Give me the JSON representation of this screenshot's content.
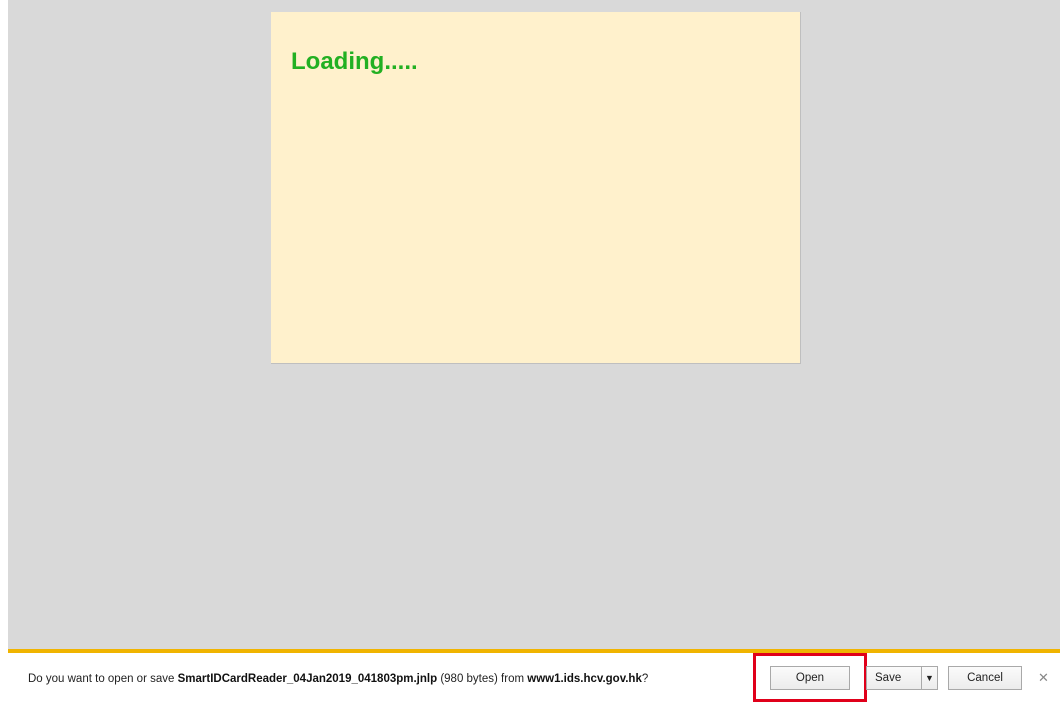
{
  "page": {
    "loading_text": "Loading.....",
    "panel_color": "#fff1cc",
    "background_color": "#d9d9d9"
  },
  "notification": {
    "prefix": "Do you want to open or save ",
    "file_name": "SmartIDCardReader_04Jan2019_041803pm.jnlp",
    "size": " (980 bytes) from ",
    "source": "www1.ids.hcv.gov.hk",
    "suffix": "?",
    "accent_color": "#f0b400",
    "buttons": {
      "open": "Open",
      "save": "Save",
      "save_arrow": "▼",
      "cancel": "Cancel",
      "close": "✕"
    },
    "highlight_color": "#e0001a"
  }
}
